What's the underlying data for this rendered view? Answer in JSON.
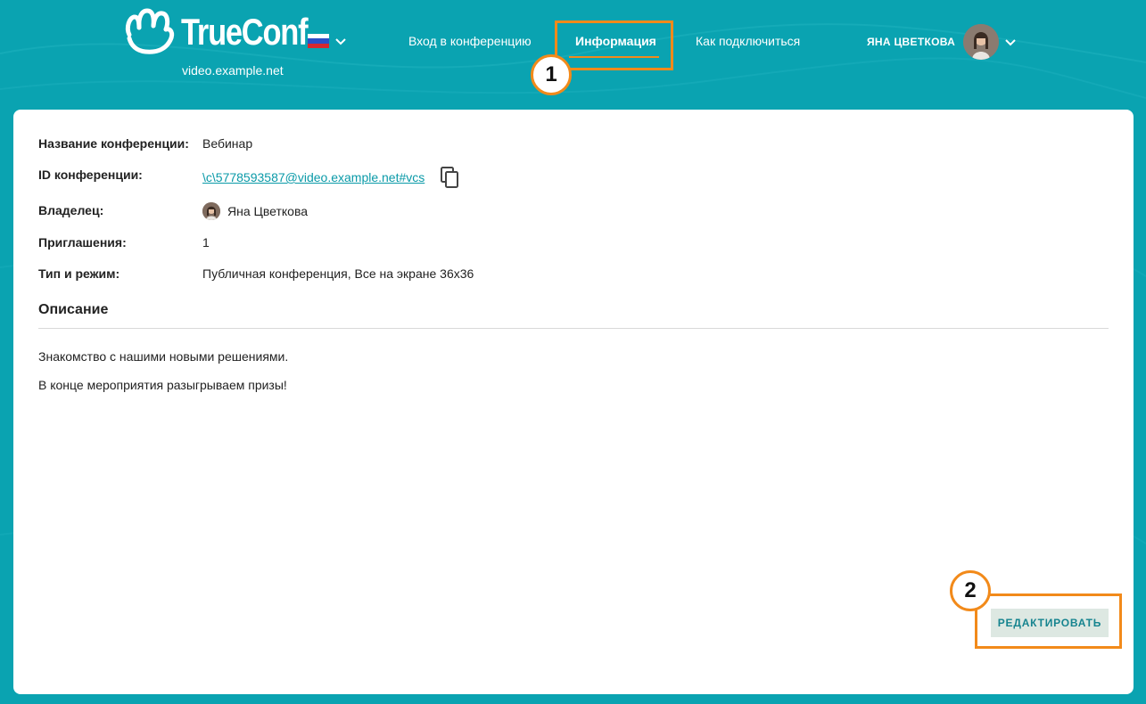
{
  "header": {
    "brand": "TrueConf",
    "server": "video.example.net",
    "nav": [
      {
        "label": "Вход в конференцию"
      },
      {
        "label": "Информация"
      },
      {
        "label": "Как подключиться"
      }
    ],
    "user_name": "ЯНА ЦВЕТКОВА"
  },
  "annotations": {
    "badge1": "1",
    "badge2": "2"
  },
  "conference": {
    "fields": [
      {
        "label": "Название конференции:",
        "value": "Вебинар"
      },
      {
        "label": "ID конференции:",
        "value": "\\c\\5778593587@video.example.net#vcs"
      },
      {
        "label": "Владелец:",
        "value": "Яна Цветкова"
      },
      {
        "label": "Приглашения:",
        "value": "1"
      },
      {
        "label": "Тип и режим:",
        "value": "Публичная конференция, Все на экране 36x36"
      }
    ],
    "description_title": "Описание",
    "description_lines": [
      "Знакомство с нашими новыми решениями.",
      "В конце мероприятия разыгрываем призы!"
    ],
    "edit_label": "РЕДАКТИРОВАТЬ"
  },
  "colors": {
    "background": "#0aa3b1",
    "accent": "#f28a1a",
    "link": "#0a9aa8",
    "button_bg": "#dde8e2",
    "button_text": "#16848f"
  },
  "icons": [
    "trueconf-logo-icon",
    "russia-flag-icon",
    "chevron-down-icon",
    "copy-icon",
    "avatar"
  ]
}
